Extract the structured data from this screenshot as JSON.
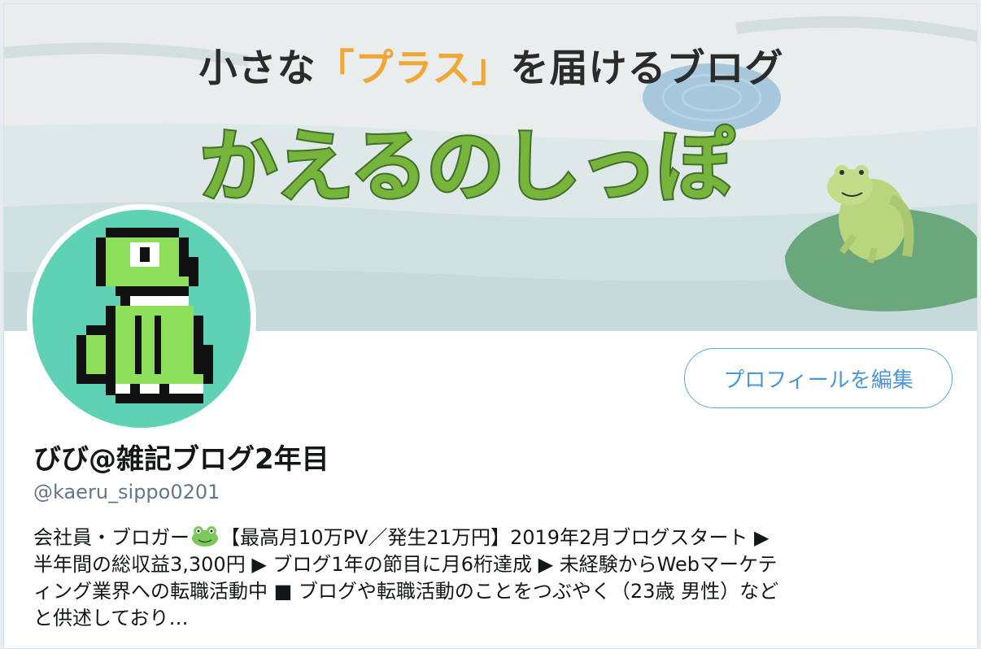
{
  "banner": {
    "tagline_before": "小さな",
    "tagline_plus": "「プラス」",
    "tagline_after": "を届けるブログ",
    "title": "かえるのしっぽ",
    "sky_color": "#e7ecec",
    "water_color": "#cfe0e0",
    "title_color": "#76b43c"
  },
  "avatar": {
    "background": "#5fd2b5",
    "icon": "pixel-frog-icon"
  },
  "profile": {
    "edit_button_label": "プロフィールを編集",
    "display_name": "びび@雑記ブログ2年目",
    "handle": "@kaeru_sippo0201",
    "bio": {
      "line1_a": "会社員・ブロガー",
      "emoji": "frog-face-icon",
      "line1_b": "【最高月10万PV／発生21万円】2019年2月ブログスタート ▶",
      "line2": "半年間の総収益3,300円 ▶ ブログ1年の節目に月6桁達成 ▶ 未経験からWebマーケテ",
      "line3": "ィング業界への転職活動中 ■ ブログや転職活動のことをつぶやく（23歳 男性）など",
      "line4": "と供述しており…"
    }
  },
  "colors": {
    "accent": "#4a96d8",
    "handle": "#657786",
    "text": "#14171a"
  }
}
